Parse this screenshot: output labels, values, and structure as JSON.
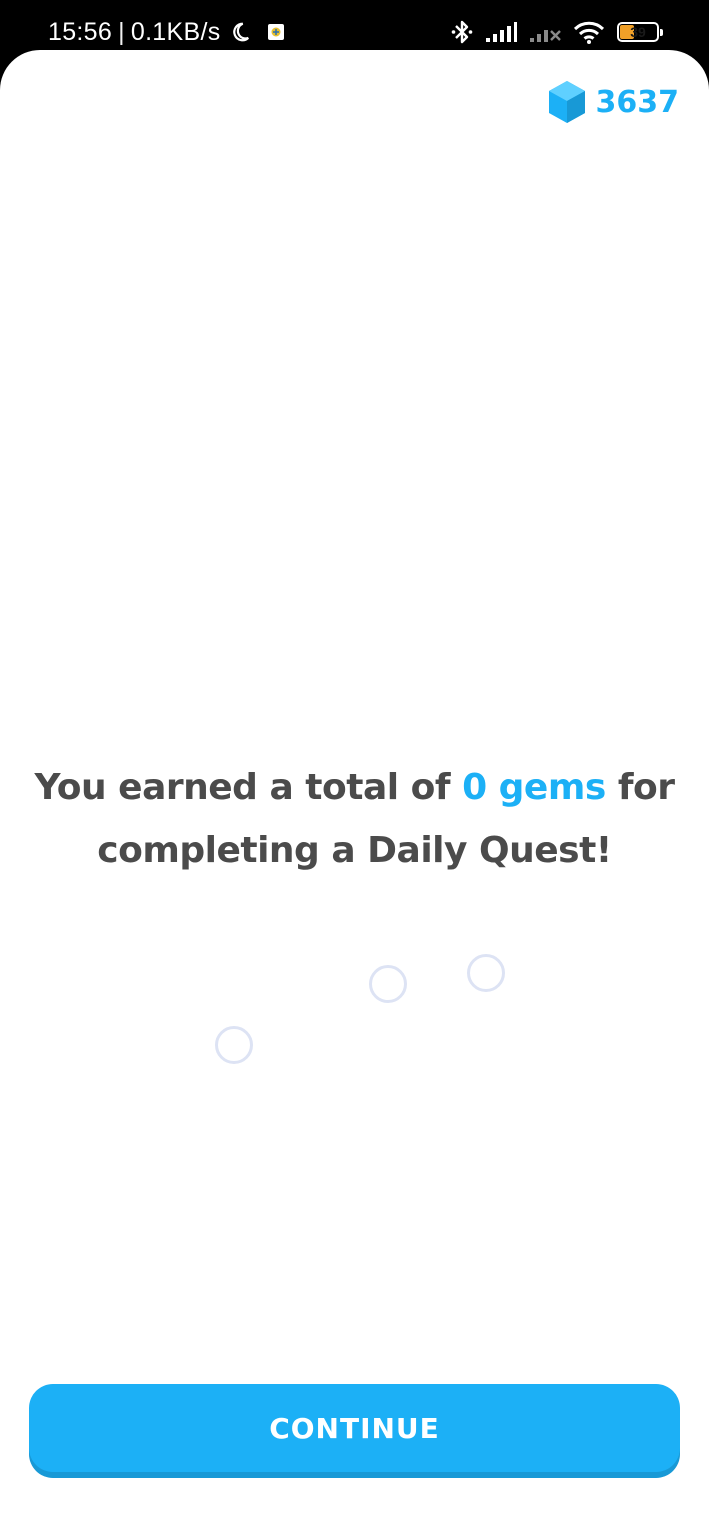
{
  "status_bar": {
    "time": "15:56",
    "separator": "|",
    "network_speed": "0.1KB/s",
    "battery_level": "39",
    "battery_fraction": 0.39,
    "icons": [
      "moon-icon",
      "app-notification-icon",
      "bluetooth-icon",
      "signal-icon",
      "signal-no-service-icon",
      "wifi-icon",
      "battery-icon"
    ]
  },
  "header": {
    "gem_count": "3637",
    "gem_icon": "gem-icon"
  },
  "message": {
    "prefix": "You earned a total of ",
    "highlight": "0 gems",
    "suffix": " for completing a Daily Quest!"
  },
  "actions": {
    "continue_label": "CONTINUE"
  },
  "colors": {
    "accent": "#1cb0f6",
    "accent_shadow": "#1899d6",
    "text": "#4b4b4b",
    "bubble": "#dde3f4"
  }
}
